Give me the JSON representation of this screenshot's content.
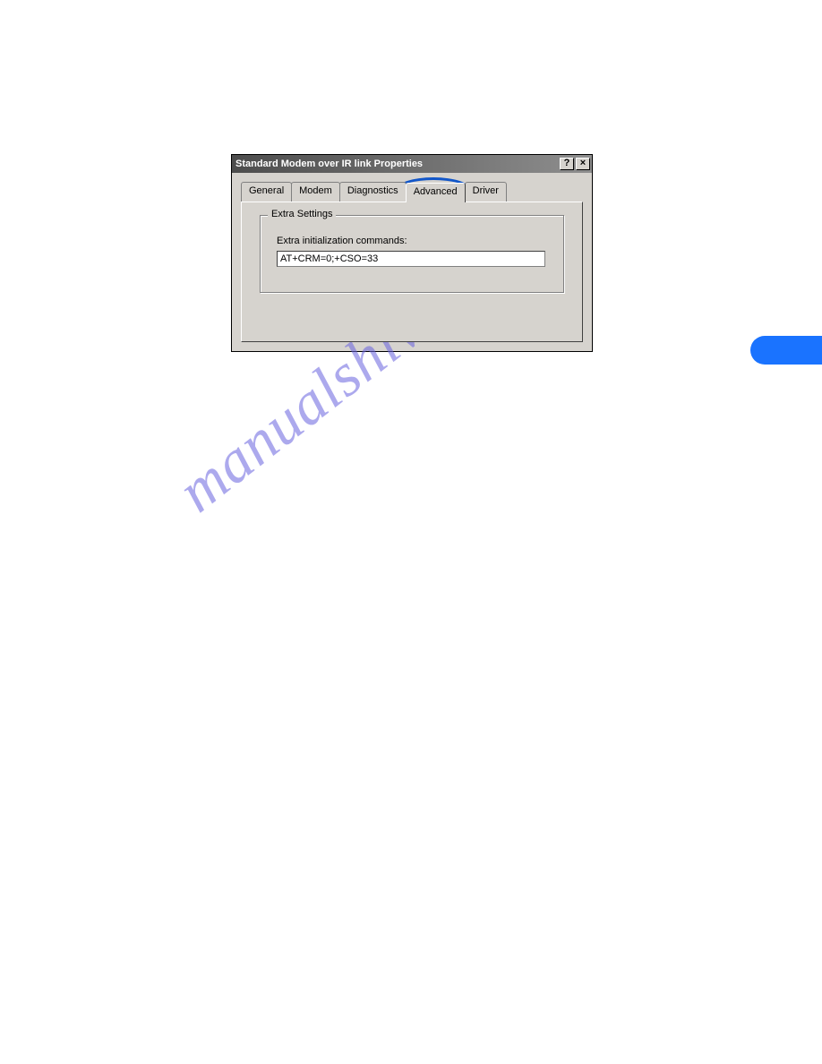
{
  "dialog": {
    "title": "Standard Modem over IR link Properties",
    "help_glyph": "?",
    "close_glyph": "×",
    "tabs": {
      "general": "General",
      "modem": "Modem",
      "diagnostics": "Diagnostics",
      "advanced": "Advanced",
      "driver": "Driver"
    },
    "group_title": "Extra Settings",
    "field_label": "Extra initialization commands:",
    "field_value": "AT+CRM=0;+CSO=33"
  },
  "watermark": "manualshive.com"
}
